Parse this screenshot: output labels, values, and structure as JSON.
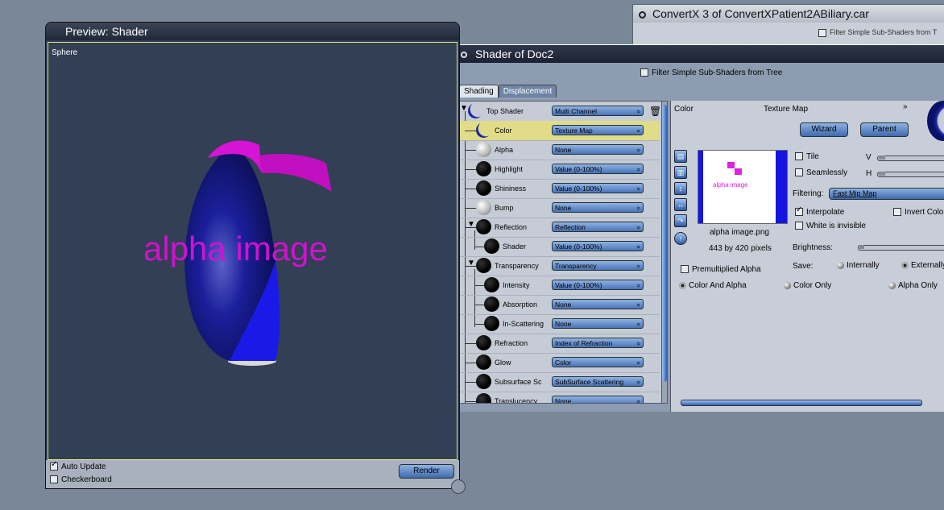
{
  "convertx": {
    "title": "ConvertX 3 of ConvertXPatient2ABiliary.car",
    "filter_label": "Filter Simple Sub-Shaders from T"
  },
  "preview": {
    "title": "Preview: Shader",
    "object_label": "Sphere",
    "render_text": "alpha image",
    "auto_update_label": "Auto Update",
    "auto_update_checked": true,
    "checkerboard_label": "Checkerboard",
    "checkerboard_checked": false,
    "render_button": "Render"
  },
  "shader": {
    "title": "Shader of Doc2",
    "filter_label": "Filter Simple Sub-Shaders from Tree",
    "tabs": [
      "Shading",
      "Displacement"
    ],
    "rows": [
      {
        "label": "Top Shader",
        "value": "Multi Channel",
        "ball": "moon",
        "selected": false
      },
      {
        "label": "Color",
        "value": "Texture Map",
        "ball": "moon",
        "selected": true
      },
      {
        "label": "Alpha",
        "value": "None",
        "ball": "white",
        "selected": false
      },
      {
        "label": "Highlight",
        "value": "Value (0-100%)",
        "ball": "black",
        "selected": false
      },
      {
        "label": "Shininess",
        "value": "Value (0-100%)",
        "ball": "black",
        "selected": false
      },
      {
        "label": "Bump",
        "value": "None",
        "ball": "white",
        "selected": false
      },
      {
        "label": "Reflection",
        "value": "Reflection",
        "ball": "black",
        "selected": false
      },
      {
        "label": "Shader",
        "value": "Value (0-100%)",
        "ball": "black",
        "selected": false
      },
      {
        "label": "Transparency",
        "value": "Transparency",
        "ball": "black",
        "selected": false
      },
      {
        "label": "Intensity",
        "value": "Value (0-100%)",
        "ball": "black",
        "selected": false
      },
      {
        "label": "Absorption",
        "value": "None",
        "ball": "black",
        "selected": false
      },
      {
        "label": "In-Scattering",
        "value": "None",
        "ball": "black",
        "selected": false
      },
      {
        "label": "Refraction",
        "value": "Index of Refraction",
        "ball": "black",
        "selected": false
      },
      {
        "label": "Glow",
        "value": "Color",
        "ball": "black",
        "selected": false
      },
      {
        "label": "Subsurface Sc",
        "value": "SubSurface Scattering",
        "ball": "black",
        "selected": false
      },
      {
        "label": "Translucency",
        "value": "None",
        "ball": "black",
        "selected": false
      }
    ],
    "detail": {
      "channel_label": "Color",
      "type_label": "Texture Map",
      "wizard_button": "Wizard",
      "parent_button": "Parent",
      "thumb_text": "alpha image",
      "filename": "alpha image.png",
      "dimensions": "443 by 420 pixels",
      "tile_label": "Tile",
      "v_label": "V",
      "seamlessly_label": "Seamlessly",
      "h_label": "H",
      "filtering_label": "Filtering:",
      "filtering_value": "Fast Mip Map",
      "interpolate_label": "Interpolate",
      "invert_color_label": "Invert Color",
      "white_invisible_label": "White is invisible",
      "brightness_label": "Brightness:",
      "save_label": "Save:",
      "internally_label": "Internally",
      "externally_label": "Externally",
      "premultiplied_label": "Premultiplied Alpha",
      "color_and_alpha_label": "Color And Alpha",
      "color_only_label": "Color Only",
      "alpha_only_label": "Alpha Only"
    }
  }
}
